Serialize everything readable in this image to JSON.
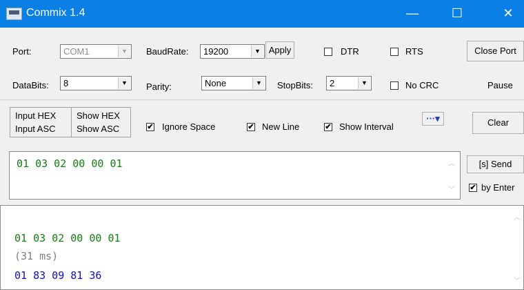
{
  "window": {
    "title": "Commix 1.4",
    "minimize_glyph": "—",
    "maximize_glyph": "☐",
    "close_glyph": "✕"
  },
  "serial": {
    "port_label": "Port:",
    "port_value": "COM1",
    "baud_label": "BaudRate:",
    "baud_value": "19200",
    "apply_label": "Apply",
    "databits_label": "DataBits:",
    "databits_value": "8",
    "parity_label": "Parity:",
    "parity_value": "None",
    "stopbits_label": "StopBits:",
    "stopbits_value": "2",
    "dtr_label": "DTR",
    "rts_label": "RTS",
    "nocrc_label": "No CRC",
    "close_port_label": "Close Port",
    "pause_label": "Pause"
  },
  "options": {
    "input_hex": "Input HEX",
    "input_asc": "Input ASC",
    "show_hex": "Show HEX",
    "show_asc": "Show ASC",
    "ignore_space": "Ignore Space",
    "new_line": "New Line",
    "show_interval": "Show Interval",
    "check_mark": "✔",
    "more_label": "···▾",
    "clear_label": "Clear"
  },
  "send": {
    "input_text": "01 03 02 00 00 01",
    "send_label": "[s] Send",
    "by_enter_label": "by Enter"
  },
  "log": [
    {
      "text": "01 03 02 00 00 01",
      "kind": "tx"
    },
    {
      "text": "(31 ms)",
      "kind": "interval"
    },
    {
      "text": "01 83 09 81 36",
      "kind": "rx"
    }
  ],
  "colors": {
    "titlebar": "#0a7fe6",
    "tx": "#108010",
    "rx": "#1010c0",
    "interval": "#808080"
  }
}
